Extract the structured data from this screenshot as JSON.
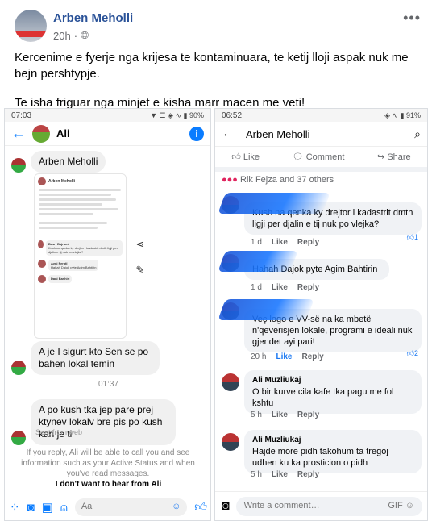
{
  "post": {
    "author": "Arben Meholli",
    "time": "20h",
    "paragraph1": "Kercenime e fyerje nga krijesa te kontaminuara, te ketij lloji aspak nuk me bejn pershtypje.",
    "paragraph2": "Te isha friguar nga minjet e kisha marr macen me veti!"
  },
  "left_shot": {
    "status_time": "07:03",
    "status_icons": "▼ ☰ ◈ ∿ ▮ 90%",
    "chat_name": "Ali",
    "msg1": "Arben Meholli",
    "nested": {
      "author": "Arben Meholli",
      "comment1_name": "Basri Bajrami",
      "comment1_text": "Kush na qenka ky drejtor i kadastrit dmth ligji per djalin e tij nuk po vlejka?",
      "comment2_name": "Avni Feratl",
      "comment2_text": "Hahah Dajok pyte Agim Bahtirin",
      "comment3_name": "Dani Bashiri"
    },
    "msg2": "A je I sigurt kto Sen se po bahen lokal temin",
    "time_sep": "01:37",
    "msg3": "A po kush tka jep pare prej ktynev lokalv bre pis po kush kari je ti",
    "sent_from": "Sent from web",
    "notice": "If you reply, Ali will be able to call you and see information such as your Active Status and when you've read messages.",
    "dont_want": "I don't want to hear from Ali",
    "input_placeholder": "Aa"
  },
  "right_shot": {
    "status_time": "06:52",
    "status_icons": "◈ ∿ ▮ 91%",
    "title": "Arben Meholli",
    "like_label": "Like",
    "comment_label": "Comment",
    "share_label": "Share",
    "reactions_text": "Rik Fejza and 37 others",
    "comments": [
      {
        "name": "",
        "text": "Kush na qenka ky drejtor i kadastrit dmth ligji per djalin e tij nuk po vlejka?",
        "time": "1 d",
        "like": "Like",
        "reply": "Reply",
        "likes": "1"
      },
      {
        "name": "",
        "text": "Hahah Dajok pyte Agim Bahtirin",
        "time": "1 d",
        "like": "Like",
        "reply": "Reply",
        "likes": ""
      },
      {
        "name": "",
        "text": "Veç logo e VV-së na ka mbetë n'qeverisjen lokale, programi e ideali nuk gjendet ayi pari!",
        "time": "20 h",
        "like": "Like",
        "reply": "Reply",
        "likes": "2"
      },
      {
        "name": "Ali Muzliukaj",
        "text": "O bir kurve cila kafe tka pagu me fol kshtu",
        "time": "5 h",
        "like": "Like",
        "reply": "Reply",
        "likes": ""
      },
      {
        "name": "Ali Muzliukaj",
        "text": "Hajde more pidh takohum ta tregoj udhen ku ka prosticion o pidh",
        "time": "5 h",
        "like": "Like",
        "reply": "Reply",
        "likes": ""
      }
    ],
    "write_placeholder": "Write a comment…"
  }
}
